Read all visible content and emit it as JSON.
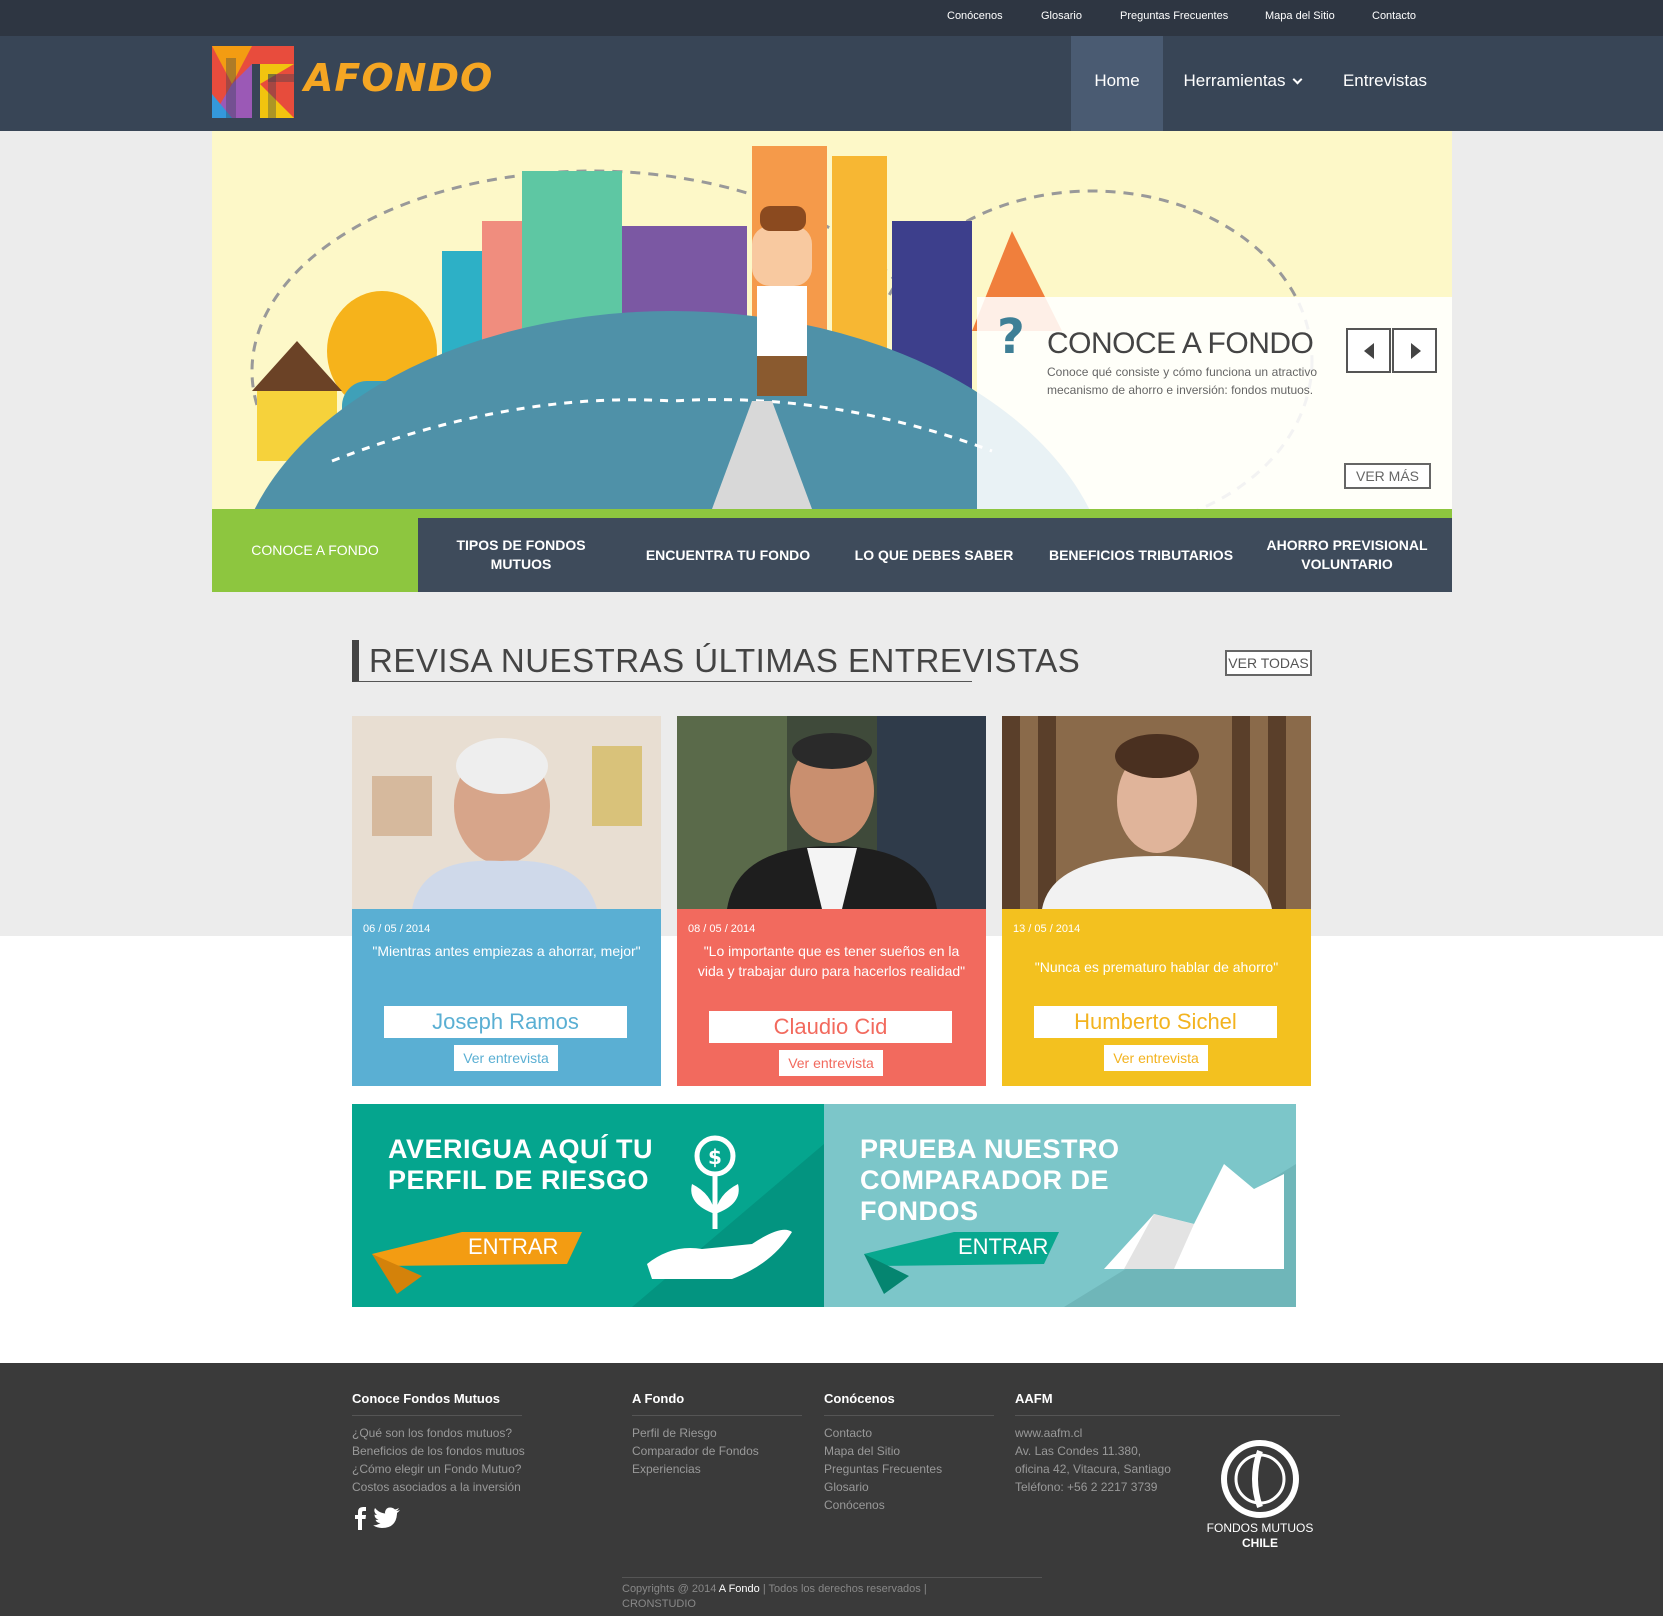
{
  "topbar": {
    "links": [
      "Conócenos",
      "Glosario",
      "Preguntas Frecuentes",
      "Mapa del Sitio",
      "Contacto"
    ]
  },
  "header": {
    "logo_text": "AFONDO",
    "nav": [
      "Home",
      "Herramientas",
      "Entrevistas"
    ]
  },
  "hero": {
    "title": "CONOCE A FONDO",
    "description": "Conoce qué consiste y cómo funciona un atractivo mecanismo de ahorro e inversión: fondos mutuos.",
    "more_label": "VER MÁS"
  },
  "hero_tabs": [
    "CONOCE A FONDO",
    "TIPOS DE FONDOS MUTUOS",
    "ENCUENTRA TU FONDO",
    "LO QUE DEBES SABER",
    "BENEFICIOS TRIBUTARIOS",
    "AHORRO PREVISIONAL VOLUNTARIO"
  ],
  "interviews": {
    "title": "REVISA NUESTRAS ÚLTIMAS ENTREVISTAS",
    "view_all": "VER TODAS",
    "cards": [
      {
        "date": "06 / 05 / 2014",
        "quote": "\"Mientras antes empiezas a ahorrar, mejor\"",
        "name": "Joseph Ramos",
        "link": "Ver entrevista",
        "color": "#5aafd3"
      },
      {
        "date": "08 / 05 / 2014",
        "quote": "\"Lo importante que es tener sueños en la vida y trabajar duro para hacerlos realidad\"",
        "name": "Claudio Cid",
        "link": "Ver entrevista",
        "color": "#f26a5e"
      },
      {
        "date": "13 / 05 / 2014",
        "quote": "\"Nunca es prematuro hablar de ahorro\"",
        "name": "Humberto Sichel",
        "link": "Ver entrevista",
        "color": "#f3c11f"
      }
    ]
  },
  "promos": [
    {
      "title_lines": [
        "AVERIGUA AQUÍ TU",
        "PERFIL DE RIESGO"
      ],
      "button": "ENTRAR",
      "color": "#05a58e"
    },
    {
      "title_lines": [
        "PRUEBA NUESTRO",
        "COMPARADOR DE",
        "FONDOS"
      ],
      "button": "ENTRAR",
      "color": "#7cc6c9"
    }
  ],
  "footer": {
    "columns": [
      {
        "title": "Conoce Fondos Mutuos",
        "links": [
          "¿Qué son los fondos mutuos?",
          "Beneficios de los fondos mutuos",
          "¿Cómo elegir un Fondo Mutuo?",
          "Costos asociados a la inversión"
        ]
      },
      {
        "title": "A Fondo",
        "links": [
          "Perfil de Riesgo",
          "Comparador de Fondos",
          "Experiencias"
        ]
      },
      {
        "title": "Conócenos",
        "links": [
          "Contacto",
          "Mapa del Sitio",
          "Preguntas Frecuentes",
          "Glosario",
          "Conócenos"
        ]
      },
      {
        "title": "AAFM",
        "links": [
          "www.aafm.cl",
          "Av. Las Condes 11.380,",
          "oficina 42, Vitacura, Santiago",
          "Teléfono: +56 2 2217 3739"
        ]
      }
    ],
    "fmc_line1": "FONDOS MUTUOS",
    "fmc_line2": "CHILE",
    "copyright_prefix": "Copyrights @ 2014",
    "copyright_brand": "A Fondo",
    "copyright_suffix": "| Todos los derechos reservados |",
    "copyright_studio": "CRONSTUDIO"
  }
}
